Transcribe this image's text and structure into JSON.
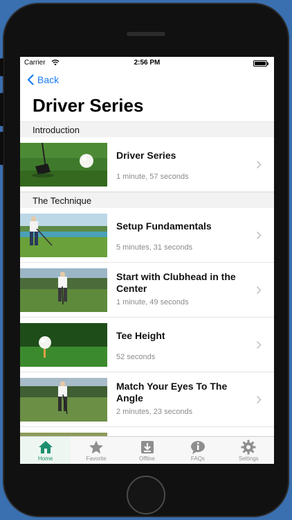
{
  "status_bar": {
    "carrier": "Carrier",
    "time": "2:56 PM"
  },
  "nav": {
    "back_label": "Back",
    "title": "Driver Series"
  },
  "sections": [
    {
      "header": "Introduction",
      "items": [
        {
          "title": "Driver Series",
          "duration": "1 minute, 57 seconds"
        }
      ]
    },
    {
      "header": "The Technique",
      "items": [
        {
          "title": "Setup Fundamentals",
          "duration": "5 minutes, 31 seconds"
        },
        {
          "title": "Start with Clubhead in the Center",
          "duration": "1 minute, 49 seconds"
        },
        {
          "title": "Tee Height",
          "duration": "52 seconds"
        },
        {
          "title": "Match Your Eyes To The Angle",
          "duration": "2 minutes, 23 seconds"
        }
      ]
    }
  ],
  "tab_bar": {
    "active": "Home",
    "accent_color": "#1e8f6e",
    "tabs": [
      {
        "label": "Home",
        "icon": "home-icon"
      },
      {
        "label": "Favorite",
        "icon": "star-icon"
      },
      {
        "label": "Offline",
        "icon": "download-icon"
      },
      {
        "label": "FAQs",
        "icon": "faq-bubble-icon"
      },
      {
        "label": "Settings",
        "icon": "gear-icon"
      }
    ]
  },
  "colors": {
    "link": "#1a7cf5",
    "section_bg": "#f2f2f2",
    "subtitle": "#8a8a8a"
  }
}
